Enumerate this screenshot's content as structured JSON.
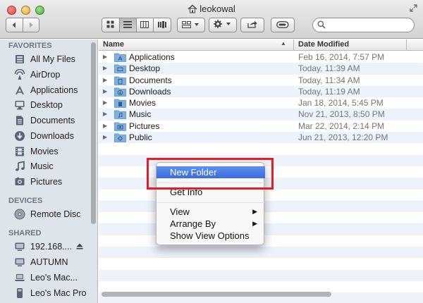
{
  "window": {
    "title": "leokowal"
  },
  "search": {
    "placeholder": ""
  },
  "toolbar": {
    "icons": [
      "back-icon",
      "forward-icon",
      "icon-view-icon",
      "list-view-icon",
      "column-view-icon",
      "cover-flow-icon",
      "arrange-icon",
      "action-gear-icon",
      "share-icon",
      "tag-icon",
      "search-icon"
    ]
  },
  "sidebar": {
    "favorites_heading": "FAVORITES",
    "favorites": [
      {
        "label": "All My Files",
        "icon": "all-files-icon"
      },
      {
        "label": "AirDrop",
        "icon": "airdrop-icon"
      },
      {
        "label": "Applications",
        "icon": "applications-icon"
      },
      {
        "label": "Desktop",
        "icon": "desktop-icon"
      },
      {
        "label": "Documents",
        "icon": "documents-icon"
      },
      {
        "label": "Downloads",
        "icon": "downloads-icon"
      },
      {
        "label": "Movies",
        "icon": "movies-icon"
      },
      {
        "label": "Music",
        "icon": "music-icon"
      },
      {
        "label": "Pictures",
        "icon": "pictures-icon"
      }
    ],
    "devices_heading": "DEVICES",
    "devices": [
      {
        "label": "Remote Disc",
        "icon": "disc-icon"
      }
    ],
    "shared_heading": "SHARED",
    "shared": [
      {
        "label": "192.168....",
        "icon": "display-icon"
      },
      {
        "label": "AUTUMN",
        "icon": "display-icon"
      },
      {
        "label": "Leo's Mac...",
        "icon": "laptop-icon"
      },
      {
        "label": "Leo's Mac Pro",
        "icon": "mac-pro-icon"
      }
    ]
  },
  "list": {
    "columns": {
      "name": "Name",
      "date": "Date Modified"
    },
    "rows": [
      {
        "name": "Applications",
        "date": "Feb 16, 2014, 7:57 PM"
      },
      {
        "name": "Desktop",
        "date": "Today, 11:39 AM"
      },
      {
        "name": "Documents",
        "date": "Today, 11:34 AM"
      },
      {
        "name": "Downloads",
        "date": "Today, 11:19 AM"
      },
      {
        "name": "Movies",
        "date": "Jan 18, 2014, 5:45 PM"
      },
      {
        "name": "Music",
        "date": "Nov 21, 2013, 8:50 PM"
      },
      {
        "name": "Pictures",
        "date": "Mar 22, 2014, 2:14 PM"
      },
      {
        "name": "Public",
        "date": "Jun 21, 2013, 12:20 PM"
      }
    ]
  },
  "context_menu": {
    "new_folder": "New Folder",
    "get_info": "Get Info",
    "view": "View",
    "arrange_by": "Arrange By",
    "show_view_options": "Show View Options",
    "submenu_arrow": "▶"
  },
  "colors": {
    "highlight": "#3b6be0",
    "annotation": "#e41e26",
    "sidebar_bg": "#dde4ea",
    "folder": "#7fb0de"
  }
}
